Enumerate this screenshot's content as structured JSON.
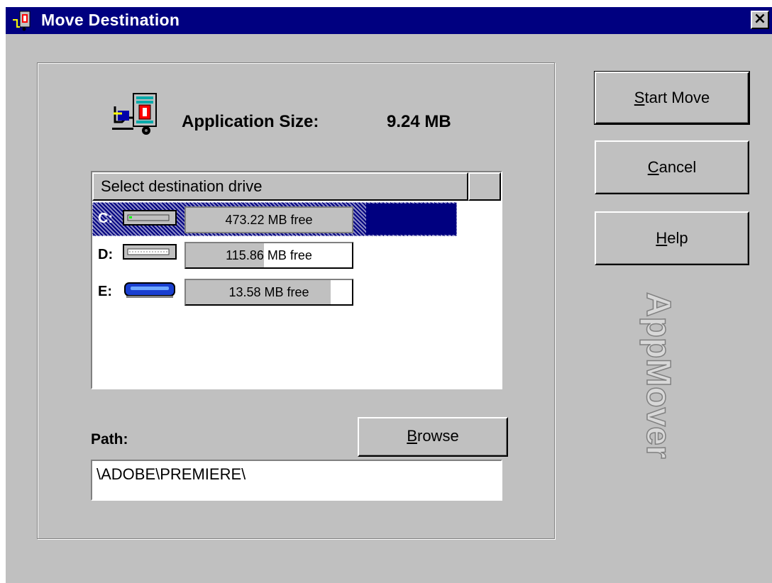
{
  "window": {
    "title": "Move Destination",
    "close_label": "×",
    "title_icon": "appmover-icon"
  },
  "app_size": {
    "label": "Application Size:",
    "value": "9.24 MB",
    "icon": "appmover-truck-icon"
  },
  "drive_list": {
    "header": "Select destination drive",
    "drives": [
      {
        "letter": "C:",
        "free": "473.22 MB free",
        "icon": "hard-drive-icon",
        "used_fraction": 1.0,
        "selected": true
      },
      {
        "letter": "D:",
        "free": "115.86 MB free",
        "icon": "hard-drive-icon",
        "used_fraction": 0.47,
        "selected": false
      },
      {
        "letter": "E:",
        "free": "13.58 MB free",
        "icon": "removable-drive-icon",
        "used_fraction": 0.87,
        "selected": false
      }
    ]
  },
  "path": {
    "label": "Path:",
    "value": "\\ADOBE\\PREMIERE\\"
  },
  "buttons": {
    "browse": {
      "prefix": "",
      "accel": "B",
      "rest": "rowse"
    },
    "start_move": {
      "prefix": "",
      "accel": "S",
      "rest": "tart Move"
    },
    "cancel": {
      "prefix": "",
      "accel": "C",
      "rest": "ancel"
    },
    "help": {
      "prefix": "",
      "accel": "H",
      "rest": "elp"
    }
  },
  "brand": {
    "text": "AppMover"
  },
  "colors": {
    "titlebar": "#000080",
    "selection": "#000080",
    "face": "#c0c0c0"
  }
}
